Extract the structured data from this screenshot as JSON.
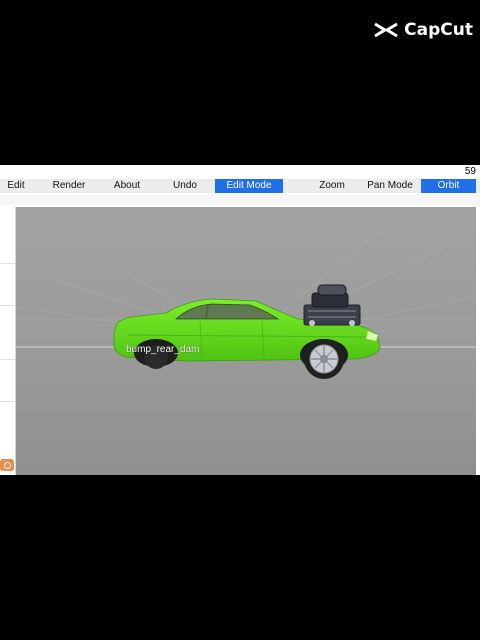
{
  "watermark": {
    "brand": "CapCut"
  },
  "app": {
    "fps": "59",
    "toolbar": [
      {
        "label": "Edit",
        "active": false
      },
      {
        "label": "Render",
        "active": false
      },
      {
        "label": "About",
        "active": false
      },
      {
        "label": "Undo",
        "active": false
      },
      {
        "label": "Edit Mode",
        "active": true
      },
      {
        "label": "Zoom",
        "active": false
      },
      {
        "label": "Pan Mode",
        "active": false
      },
      {
        "label": "Orbit",
        "active": true
      }
    ],
    "viewport": {
      "part_label": "bump_rear_dam",
      "car_color": "#66e018",
      "background_color": "#9b9b9b"
    }
  }
}
